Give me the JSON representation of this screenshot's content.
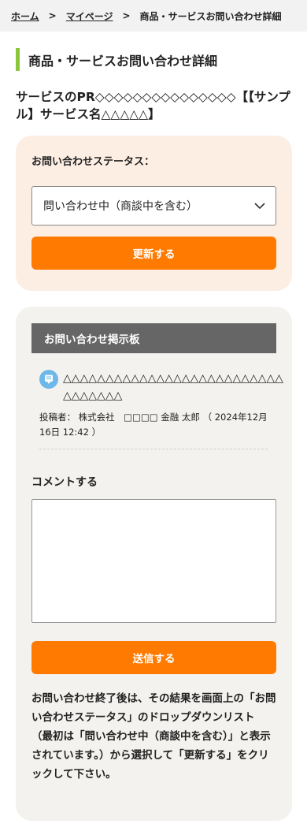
{
  "breadcrumb": {
    "home": "ホーム",
    "separator": ">",
    "mypage": "マイページ",
    "current": "商品・サービスお問い合わせ詳細"
  },
  "page": {
    "title": "商品・サービスお問い合わせ詳細",
    "service_name": "サービスのPR◇◇◇◇◇◇◇◇◇◇◇◇◇◇◇【【サンプル】サービス名△△△△△】"
  },
  "status": {
    "label": "お問い合わせステータス：",
    "selected": "問い合わせ中（商談中を含む）",
    "update_button": "更新する"
  },
  "board": {
    "header": "お問い合わせ掲示板",
    "post": {
      "icon": "speech-bubble-icon",
      "title": "△△△△△△△△△△△△△△△△△△△△△△△△△△△△△△△△△",
      "meta": "投稿者： 株式会社　□□□□ 金融 太郎 （ 2024年12月16日 12:42 ）"
    },
    "comment_label": "コメントする",
    "comment_value": "",
    "send_button": "送信する",
    "note_lines": [
      "お問い合わせ終了後は、その結果を画面上の「お問い合わせステータス」のドロップダウンリスト",
      "（最初は「問い合わせ中（商談中を含む）」と表示されています。）から選択して「更新する」をクリックして下さい。"
    ]
  },
  "colors": {
    "accent": "#ff7a00",
    "title_bar": "#8cc63f",
    "status_bg": "#fdeee4",
    "board_bg": "#f4f2ef",
    "board_header": "#666666",
    "post_icon": "#6db8e8"
  }
}
